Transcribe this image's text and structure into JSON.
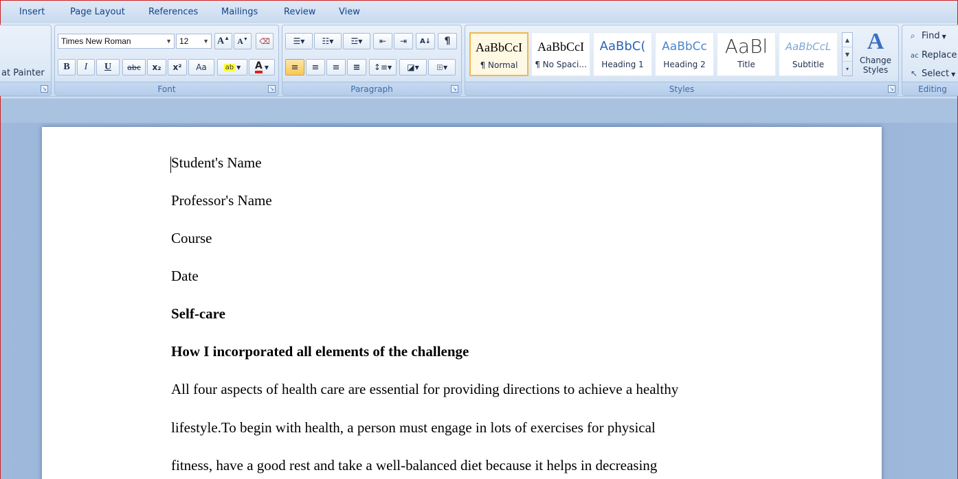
{
  "tabs": [
    "Insert",
    "Page Layout",
    "References",
    "Mailings",
    "Review",
    "View"
  ],
  "clipboard": {
    "format_painter": "at Painter"
  },
  "font": {
    "name": "Times New Roman",
    "size": "12",
    "group_label": "Font",
    "bold": "B",
    "italic": "I",
    "underline": "U",
    "strike": "abc",
    "subscript": "x₂",
    "superscript": "x²",
    "change_case": "Aa"
  },
  "paragraph": {
    "group_label": "Paragraph"
  },
  "styles": {
    "group_label": "Styles",
    "items": [
      {
        "sample": "AaBbCcI",
        "name": "¶ Normal"
      },
      {
        "sample": "AaBbCcI",
        "name": "¶ No Spaci..."
      },
      {
        "sample": "AaBbC(",
        "name": "Heading 1"
      },
      {
        "sample": "AaBbCc",
        "name": "Heading 2"
      },
      {
        "sample": "AaBl",
        "name": "Title"
      },
      {
        "sample": "AaBbCcL",
        "name": "Subtitle"
      }
    ],
    "change_styles": "Change Styles"
  },
  "editing": {
    "group_label": "Editing",
    "find": "Find",
    "replace": "Replace",
    "select": "Select"
  },
  "document": {
    "lines": [
      "Student's Name",
      "Professor's Name",
      "Course",
      "Date",
      "Self-care",
      "How I incorporated all elements of the challenge",
      "All four aspects of health care are essential for providing directions to achieve a healthy",
      "lifestyle.To begin with health, a person must engage in lots of exercises for physical",
      "fitness, have a good rest and take a well-balanced diet because it helps in decreasing"
    ]
  }
}
